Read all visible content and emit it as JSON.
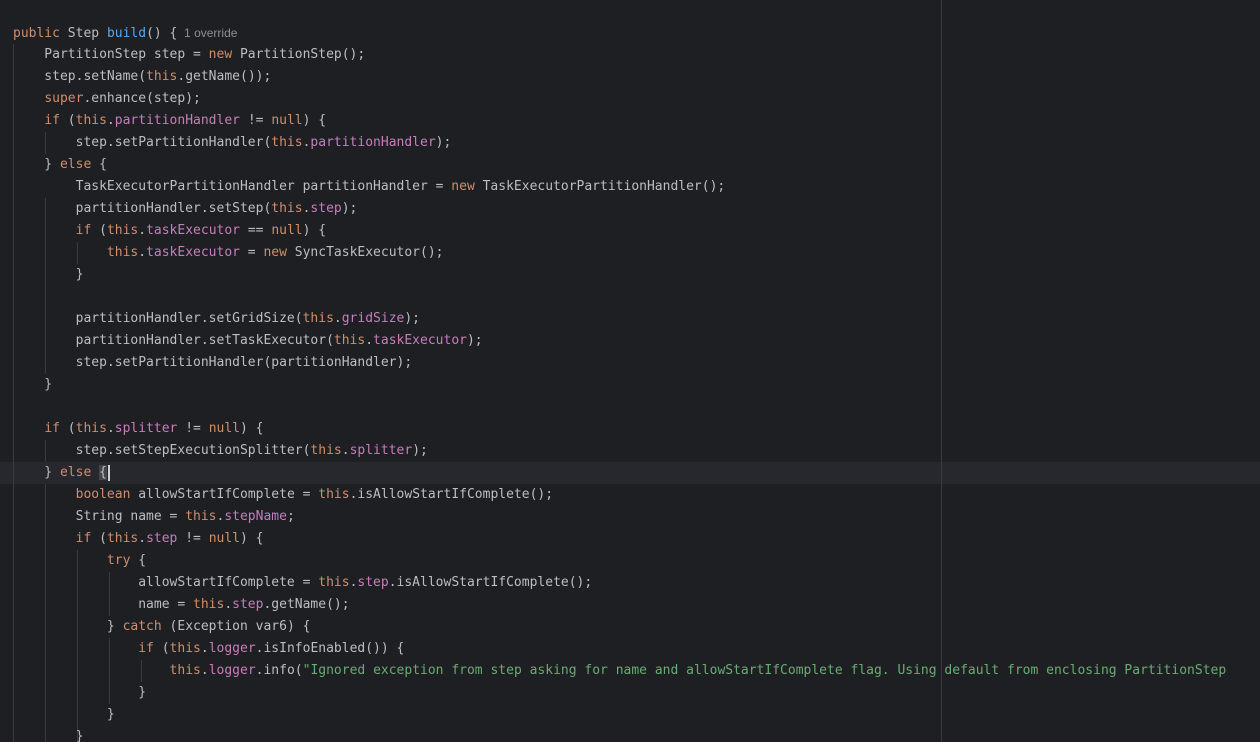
{
  "editor": {
    "colors": {
      "background": "#1e1f22",
      "caret_line": "#26282e",
      "text": "#bcbec4",
      "keyword": "#cf8e6d",
      "field": "#c77dbb",
      "method_declaration": "#56a8f5",
      "string": "#6aab73",
      "inlay_hint": "#8c8f94"
    },
    "inlay_hint": "1 override",
    "lines": [
      [
        {
          "t": "public",
          "c": "kw"
        },
        {
          "t": " Step "
        },
        {
          "t": "build",
          "c": "fn"
        },
        {
          "t": "() {"
        },
        {
          "t": "  1 override",
          "c": "hint"
        }
      ],
      [
        {
          "t": "    PartitionStep step = "
        },
        {
          "t": "new",
          "c": "kw"
        },
        {
          "t": " PartitionStep();"
        }
      ],
      [
        {
          "t": "    step.setName("
        },
        {
          "t": "this",
          "c": "kw"
        },
        {
          "t": ".getName());"
        }
      ],
      [
        {
          "t": "    "
        },
        {
          "t": "super",
          "c": "kw"
        },
        {
          "t": ".enhance(step);"
        }
      ],
      [
        {
          "t": "    "
        },
        {
          "t": "if",
          "c": "kw"
        },
        {
          "t": " ("
        },
        {
          "t": "this",
          "c": "kw"
        },
        {
          "t": "."
        },
        {
          "t": "partitionHandler",
          "c": "fld"
        },
        {
          "t": " != "
        },
        {
          "t": "null",
          "c": "kw"
        },
        {
          "t": ") {"
        }
      ],
      [
        {
          "t": "        step.setPartitionHandler("
        },
        {
          "t": "this",
          "c": "kw"
        },
        {
          "t": "."
        },
        {
          "t": "partitionHandler",
          "c": "fld"
        },
        {
          "t": ");"
        }
      ],
      [
        {
          "t": "    } "
        },
        {
          "t": "else",
          "c": "kw"
        },
        {
          "t": " {"
        }
      ],
      [
        {
          "t": "        TaskExecutorPartitionHandler partitionHandler = "
        },
        {
          "t": "new",
          "c": "kw"
        },
        {
          "t": " TaskExecutorPartitionHandler();"
        }
      ],
      [
        {
          "t": "        partitionHandler.setStep("
        },
        {
          "t": "this",
          "c": "kw"
        },
        {
          "t": "."
        },
        {
          "t": "step",
          "c": "fld"
        },
        {
          "t": ");"
        }
      ],
      [
        {
          "t": "        "
        },
        {
          "t": "if",
          "c": "kw"
        },
        {
          "t": " ("
        },
        {
          "t": "this",
          "c": "kw"
        },
        {
          "t": "."
        },
        {
          "t": "taskExecutor",
          "c": "fld"
        },
        {
          "t": " == "
        },
        {
          "t": "null",
          "c": "kw"
        },
        {
          "t": ") {"
        }
      ],
      [
        {
          "t": "            "
        },
        {
          "t": "this",
          "c": "kw"
        },
        {
          "t": "."
        },
        {
          "t": "taskExecutor",
          "c": "fld"
        },
        {
          "t": " = "
        },
        {
          "t": "new",
          "c": "kw"
        },
        {
          "t": " SyncTaskExecutor();"
        }
      ],
      [
        {
          "t": "        }"
        }
      ],
      [],
      [
        {
          "t": "        partitionHandler.setGridSize("
        },
        {
          "t": "this",
          "c": "kw"
        },
        {
          "t": "."
        },
        {
          "t": "gridSize",
          "c": "fld"
        },
        {
          "t": ");"
        }
      ],
      [
        {
          "t": "        partitionHandler.setTaskExecutor("
        },
        {
          "t": "this",
          "c": "kw"
        },
        {
          "t": "."
        },
        {
          "t": "taskExecutor",
          "c": "fld"
        },
        {
          "t": ");"
        }
      ],
      [
        {
          "t": "        step.setPartitionHandler(partitionHandler);"
        }
      ],
      [
        {
          "t": "    }"
        }
      ],
      [],
      [
        {
          "t": "    "
        },
        {
          "t": "if",
          "c": "kw"
        },
        {
          "t": " ("
        },
        {
          "t": "this",
          "c": "kw"
        },
        {
          "t": "."
        },
        {
          "t": "splitter",
          "c": "fld"
        },
        {
          "t": " != "
        },
        {
          "t": "null",
          "c": "kw"
        },
        {
          "t": ") {"
        }
      ],
      [
        {
          "t": "        step.setStepExecutionSplitter("
        },
        {
          "t": "this",
          "c": "kw"
        },
        {
          "t": "."
        },
        {
          "t": "splitter",
          "c": "fld"
        },
        {
          "t": ");"
        }
      ],
      [
        {
          "t": "    } "
        },
        {
          "t": "else",
          "c": "kw"
        },
        {
          "t": " "
        },
        {
          "t": "{",
          "c": "hl-brace"
        }
      ],
      [
        {
          "t": "        "
        },
        {
          "t": "boolean",
          "c": "kw"
        },
        {
          "t": " allowStartIfComplete = "
        },
        {
          "t": "this",
          "c": "kw"
        },
        {
          "t": ".isAllowStartIfComplete();"
        }
      ],
      [
        {
          "t": "        String name = "
        },
        {
          "t": "this",
          "c": "kw"
        },
        {
          "t": "."
        },
        {
          "t": "stepName",
          "c": "fld"
        },
        {
          "t": ";"
        }
      ],
      [
        {
          "t": "        "
        },
        {
          "t": "if",
          "c": "kw"
        },
        {
          "t": " ("
        },
        {
          "t": "this",
          "c": "kw"
        },
        {
          "t": "."
        },
        {
          "t": "step",
          "c": "fld"
        },
        {
          "t": " != "
        },
        {
          "t": "null",
          "c": "kw"
        },
        {
          "t": ") {"
        }
      ],
      [
        {
          "t": "            "
        },
        {
          "t": "try",
          "c": "kw"
        },
        {
          "t": " {"
        }
      ],
      [
        {
          "t": "                allowStartIfComplete = "
        },
        {
          "t": "this",
          "c": "kw"
        },
        {
          "t": "."
        },
        {
          "t": "step",
          "c": "fld"
        },
        {
          "t": ".isAllowStartIfComplete();"
        }
      ],
      [
        {
          "t": "                name = "
        },
        {
          "t": "this",
          "c": "kw"
        },
        {
          "t": "."
        },
        {
          "t": "step",
          "c": "fld"
        },
        {
          "t": ".getName();"
        }
      ],
      [
        {
          "t": "            } "
        },
        {
          "t": "catch",
          "c": "kw"
        },
        {
          "t": " (Exception var6) {"
        }
      ],
      [
        {
          "t": "                "
        },
        {
          "t": "if",
          "c": "kw"
        },
        {
          "t": " ("
        },
        {
          "t": "this",
          "c": "kw"
        },
        {
          "t": "."
        },
        {
          "t": "logger",
          "c": "fld"
        },
        {
          "t": ".isInfoEnabled()) {"
        }
      ],
      [
        {
          "t": "                    "
        },
        {
          "t": "this",
          "c": "kw"
        },
        {
          "t": "."
        },
        {
          "t": "logger",
          "c": "fld"
        },
        {
          "t": ".info("
        },
        {
          "t": "\"Ignored exception from step asking for name and allowStartIfComplete flag. Using default from enclosing PartitionStep",
          "c": "str"
        }
      ],
      [
        {
          "t": "                }"
        }
      ],
      [
        {
          "t": "            }"
        }
      ],
      [
        {
          "t": "        }"
        }
      ]
    ]
  }
}
